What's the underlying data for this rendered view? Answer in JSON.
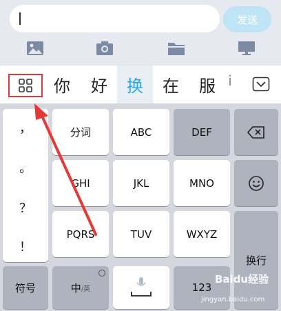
{
  "input_bar": {
    "placeholder": "",
    "send_label": "发送"
  },
  "attachments": [
    "image-icon",
    "camera-icon",
    "folder-icon",
    "screen-icon"
  ],
  "candidates": {
    "words": [
      "你",
      "好",
      "换",
      "在",
      "服",
      "i"
    ],
    "highlighted_index": 2
  },
  "keyboard": {
    "punctuation": [
      "，",
      "。",
      "？",
      "！"
    ],
    "keys": {
      "fenci": "分词",
      "abc": "ABC",
      "def": "DEF",
      "ghi": "GHI",
      "jkl": "JKL",
      "mno": "MNO",
      "pqrs": "PQRS",
      "tuv": "TUV",
      "wxyz": "WXYZ",
      "enter": "换行",
      "symbols": "符号",
      "lang_main": "中",
      "lang_sub": "/英",
      "num": "123"
    }
  },
  "watermark": {
    "brand": "Baidu经验",
    "url": "jingyan.baidu.com"
  },
  "colors": {
    "accent": "#26a9e8",
    "send_bg": "#bfe4f5",
    "highlight_box": "#e03a3a",
    "annotation_arrow": "#e53935"
  }
}
